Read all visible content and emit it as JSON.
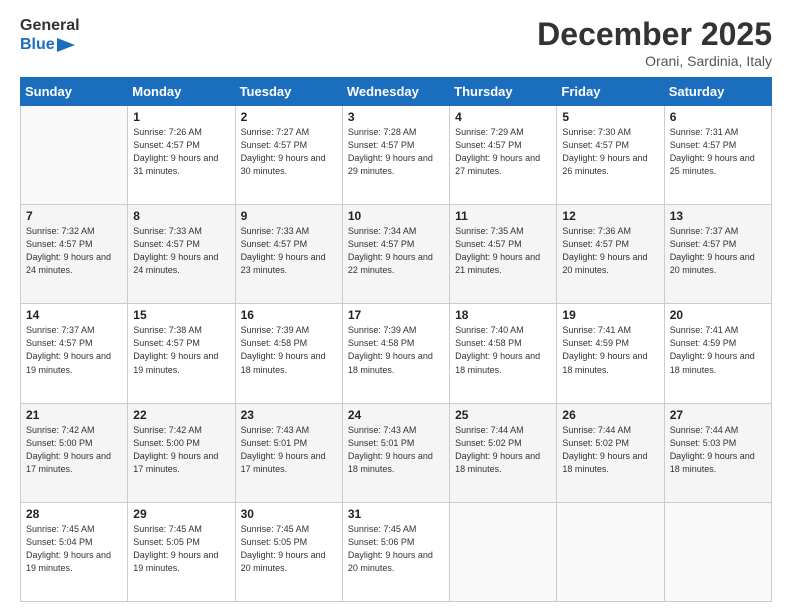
{
  "logo": {
    "text_general": "General",
    "text_blue": "Blue"
  },
  "header": {
    "month": "December 2025",
    "location": "Orani, Sardinia, Italy"
  },
  "days_of_week": [
    "Sunday",
    "Monday",
    "Tuesday",
    "Wednesday",
    "Thursday",
    "Friday",
    "Saturday"
  ],
  "weeks": [
    [
      {
        "day": "",
        "empty": true
      },
      {
        "day": "1",
        "sunrise": "7:26 AM",
        "sunset": "4:57 PM",
        "daylight": "9 hours and 31 minutes."
      },
      {
        "day": "2",
        "sunrise": "7:27 AM",
        "sunset": "4:57 PM",
        "daylight": "9 hours and 30 minutes."
      },
      {
        "day": "3",
        "sunrise": "7:28 AM",
        "sunset": "4:57 PM",
        "daylight": "9 hours and 29 minutes."
      },
      {
        "day": "4",
        "sunrise": "7:29 AM",
        "sunset": "4:57 PM",
        "daylight": "9 hours and 27 minutes."
      },
      {
        "day": "5",
        "sunrise": "7:30 AM",
        "sunset": "4:57 PM",
        "daylight": "9 hours and 26 minutes."
      },
      {
        "day": "6",
        "sunrise": "7:31 AM",
        "sunset": "4:57 PM",
        "daylight": "9 hours and 25 minutes."
      }
    ],
    [
      {
        "day": "7",
        "sunrise": "7:32 AM",
        "sunset": "4:57 PM",
        "daylight": "9 hours and 24 minutes."
      },
      {
        "day": "8",
        "sunrise": "7:33 AM",
        "sunset": "4:57 PM",
        "daylight": "9 hours and 24 minutes."
      },
      {
        "day": "9",
        "sunrise": "7:33 AM",
        "sunset": "4:57 PM",
        "daylight": "9 hours and 23 minutes."
      },
      {
        "day": "10",
        "sunrise": "7:34 AM",
        "sunset": "4:57 PM",
        "daylight": "9 hours and 22 minutes."
      },
      {
        "day": "11",
        "sunrise": "7:35 AM",
        "sunset": "4:57 PM",
        "daylight": "9 hours and 21 minutes."
      },
      {
        "day": "12",
        "sunrise": "7:36 AM",
        "sunset": "4:57 PM",
        "daylight": "9 hours and 20 minutes."
      },
      {
        "day": "13",
        "sunrise": "7:37 AM",
        "sunset": "4:57 PM",
        "daylight": "9 hours and 20 minutes."
      }
    ],
    [
      {
        "day": "14",
        "sunrise": "7:37 AM",
        "sunset": "4:57 PM",
        "daylight": "9 hours and 19 minutes."
      },
      {
        "day": "15",
        "sunrise": "7:38 AM",
        "sunset": "4:57 PM",
        "daylight": "9 hours and 19 minutes."
      },
      {
        "day": "16",
        "sunrise": "7:39 AM",
        "sunset": "4:58 PM",
        "daylight": "9 hours and 18 minutes."
      },
      {
        "day": "17",
        "sunrise": "7:39 AM",
        "sunset": "4:58 PM",
        "daylight": "9 hours and 18 minutes."
      },
      {
        "day": "18",
        "sunrise": "7:40 AM",
        "sunset": "4:58 PM",
        "daylight": "9 hours and 18 minutes."
      },
      {
        "day": "19",
        "sunrise": "7:41 AM",
        "sunset": "4:59 PM",
        "daylight": "9 hours and 18 minutes."
      },
      {
        "day": "20",
        "sunrise": "7:41 AM",
        "sunset": "4:59 PM",
        "daylight": "9 hours and 18 minutes."
      }
    ],
    [
      {
        "day": "21",
        "sunrise": "7:42 AM",
        "sunset": "5:00 PM",
        "daylight": "9 hours and 17 minutes."
      },
      {
        "day": "22",
        "sunrise": "7:42 AM",
        "sunset": "5:00 PM",
        "daylight": "9 hours and 17 minutes."
      },
      {
        "day": "23",
        "sunrise": "7:43 AM",
        "sunset": "5:01 PM",
        "daylight": "9 hours and 17 minutes."
      },
      {
        "day": "24",
        "sunrise": "7:43 AM",
        "sunset": "5:01 PM",
        "daylight": "9 hours and 18 minutes."
      },
      {
        "day": "25",
        "sunrise": "7:44 AM",
        "sunset": "5:02 PM",
        "daylight": "9 hours and 18 minutes."
      },
      {
        "day": "26",
        "sunrise": "7:44 AM",
        "sunset": "5:02 PM",
        "daylight": "9 hours and 18 minutes."
      },
      {
        "day": "27",
        "sunrise": "7:44 AM",
        "sunset": "5:03 PM",
        "daylight": "9 hours and 18 minutes."
      }
    ],
    [
      {
        "day": "28",
        "sunrise": "7:45 AM",
        "sunset": "5:04 PM",
        "daylight": "9 hours and 19 minutes."
      },
      {
        "day": "29",
        "sunrise": "7:45 AM",
        "sunset": "5:05 PM",
        "daylight": "9 hours and 19 minutes."
      },
      {
        "day": "30",
        "sunrise": "7:45 AM",
        "sunset": "5:05 PM",
        "daylight": "9 hours and 20 minutes."
      },
      {
        "day": "31",
        "sunrise": "7:45 AM",
        "sunset": "5:06 PM",
        "daylight": "9 hours and 20 minutes."
      },
      {
        "day": "",
        "empty": true
      },
      {
        "day": "",
        "empty": true
      },
      {
        "day": "",
        "empty": true
      }
    ]
  ],
  "labels": {
    "sunrise": "Sunrise:",
    "sunset": "Sunset:",
    "daylight": "Daylight:"
  }
}
